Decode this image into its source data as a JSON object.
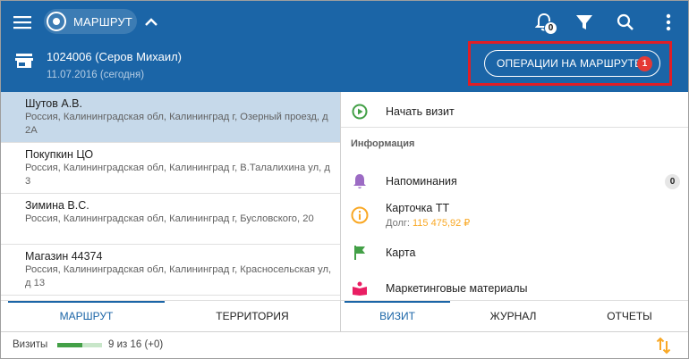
{
  "header": {
    "route_chip_label": "МАРШРУТ",
    "notifications_count": "0",
    "client_name": "1024006 (Серов Михаил)",
    "client_date": "11.07.2016 (сегодня)",
    "operations_button_label": "ОПЕРАЦИИ НА МАРШРУТЕ",
    "operations_badge": "1",
    "icons": [
      "menu-icon",
      "route-icon",
      "chevron-up-icon",
      "bell-icon",
      "filter-icon",
      "search-icon",
      "more-vert-icon",
      "store-icon"
    ],
    "accent_color": "#1b65a7",
    "highlight_color": "#e01e26"
  },
  "route_list": [
    {
      "title": "Шутов А.В.",
      "address": "Россия, Калининградская обл, Калининград г, Озерный проезд, д 2А",
      "selected": true
    },
    {
      "title": "Покупкин ЦО",
      "address": "Россия, Калининградская обл, Калининград г, В.Талалихина ул, д 3",
      "selected": false
    },
    {
      "title": "Зимина В.С.",
      "address": "Россия, Калининградская обл, Калининград г, Бусловского, 20",
      "selected": false
    },
    {
      "title": "Магазин 44374",
      "address": "Россия, Калининградская обл, Калининград г, Красносельская ул, д 13",
      "selected": false
    }
  ],
  "details": {
    "start_visit_label": "Начать визит",
    "section_info": "Информация",
    "reminders_label": "Напоминания",
    "reminders_count": "0",
    "card_label": "Карточка ТТ",
    "debt_label": "Долг:",
    "debt_value": "115 475,92 ₽",
    "map_label": "Карта",
    "marketing_label": "Маркетинговые материалы"
  },
  "tabs_left": [
    {
      "label": "МАРШРУТ",
      "active": true
    },
    {
      "label": "ТЕРРИТОРИЯ",
      "active": false
    }
  ],
  "tabs_right": [
    {
      "label": "ВИЗИТ",
      "active": true
    },
    {
      "label": "ЖУРНАЛ",
      "active": false
    },
    {
      "label": "ОТЧЕТЫ",
      "active": false
    }
  ],
  "footer": {
    "visits_label": "Визиты",
    "visits_done": 9,
    "visits_total": 16,
    "visits_progress": 0.5625,
    "visits_text": "9 из 16 (+0)"
  }
}
